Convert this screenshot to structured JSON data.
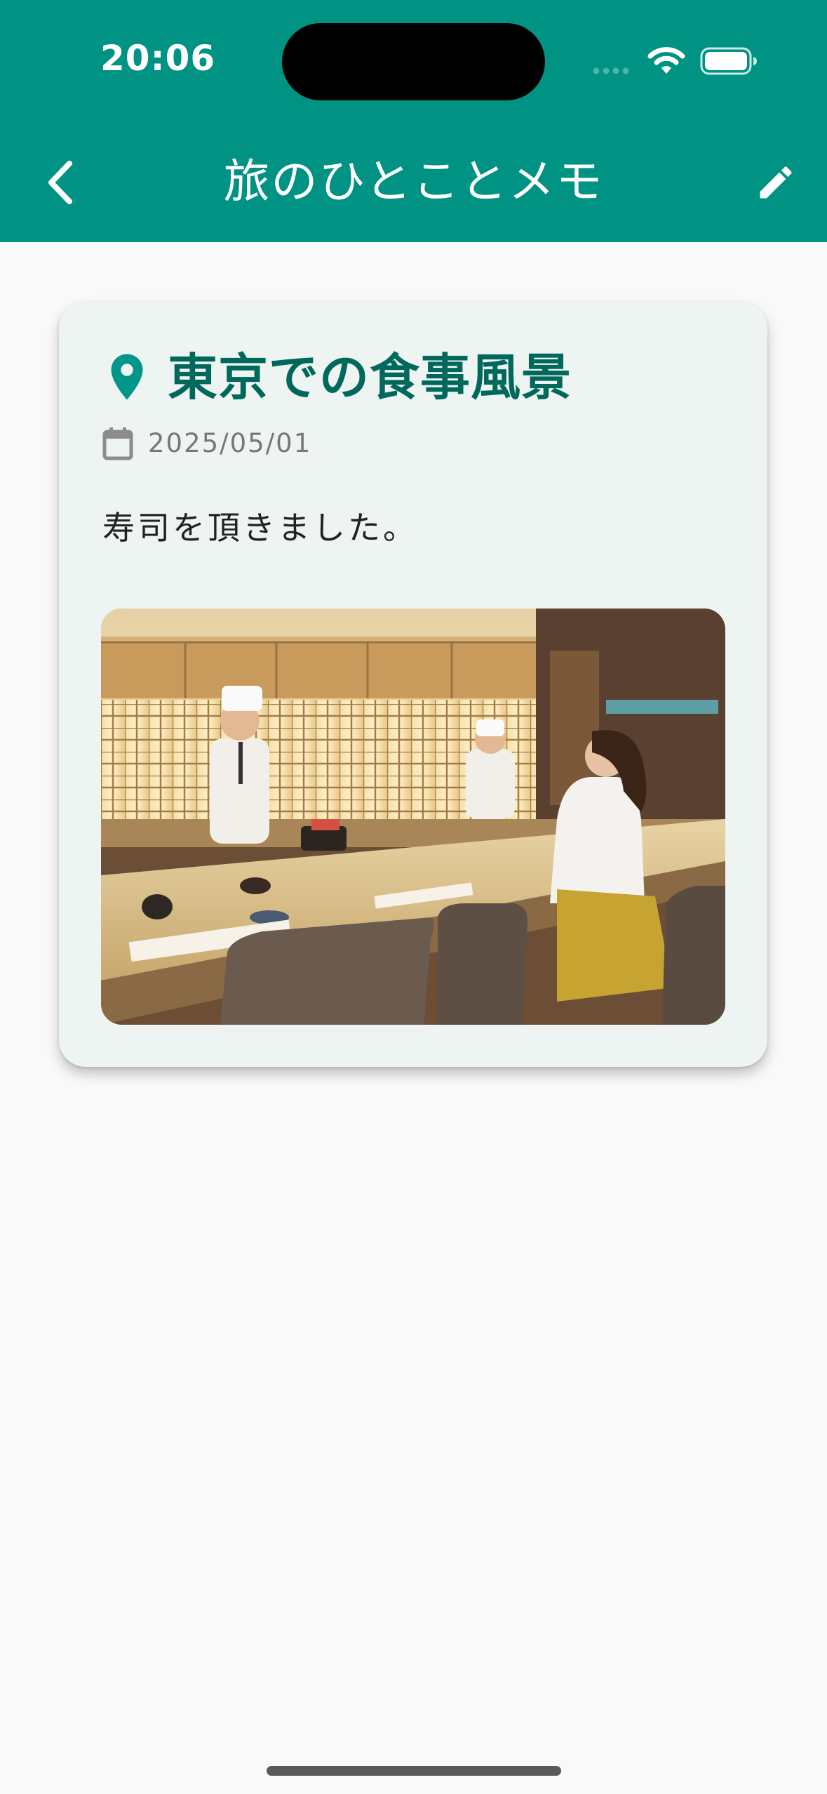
{
  "status_bar": {
    "time": "20:06",
    "signal_icon": "cellular-signal-icon",
    "wifi_icon": "wifi-icon",
    "battery_icon": "battery-icon"
  },
  "app_bar": {
    "title": "旅のひとことメモ",
    "back_icon": "chevron-left-icon",
    "edit_icon": "pencil-icon",
    "background_color": "#009283"
  },
  "memo": {
    "title": "東京での食事風景",
    "title_icon": "location-pin-icon",
    "date_icon": "calendar-icon",
    "date": "2025/05/01",
    "body": "寿司を頂きました。",
    "photo_icon": "photo-sushi-counter",
    "title_color": "#00695c",
    "card_background": "#eef4f2"
  }
}
